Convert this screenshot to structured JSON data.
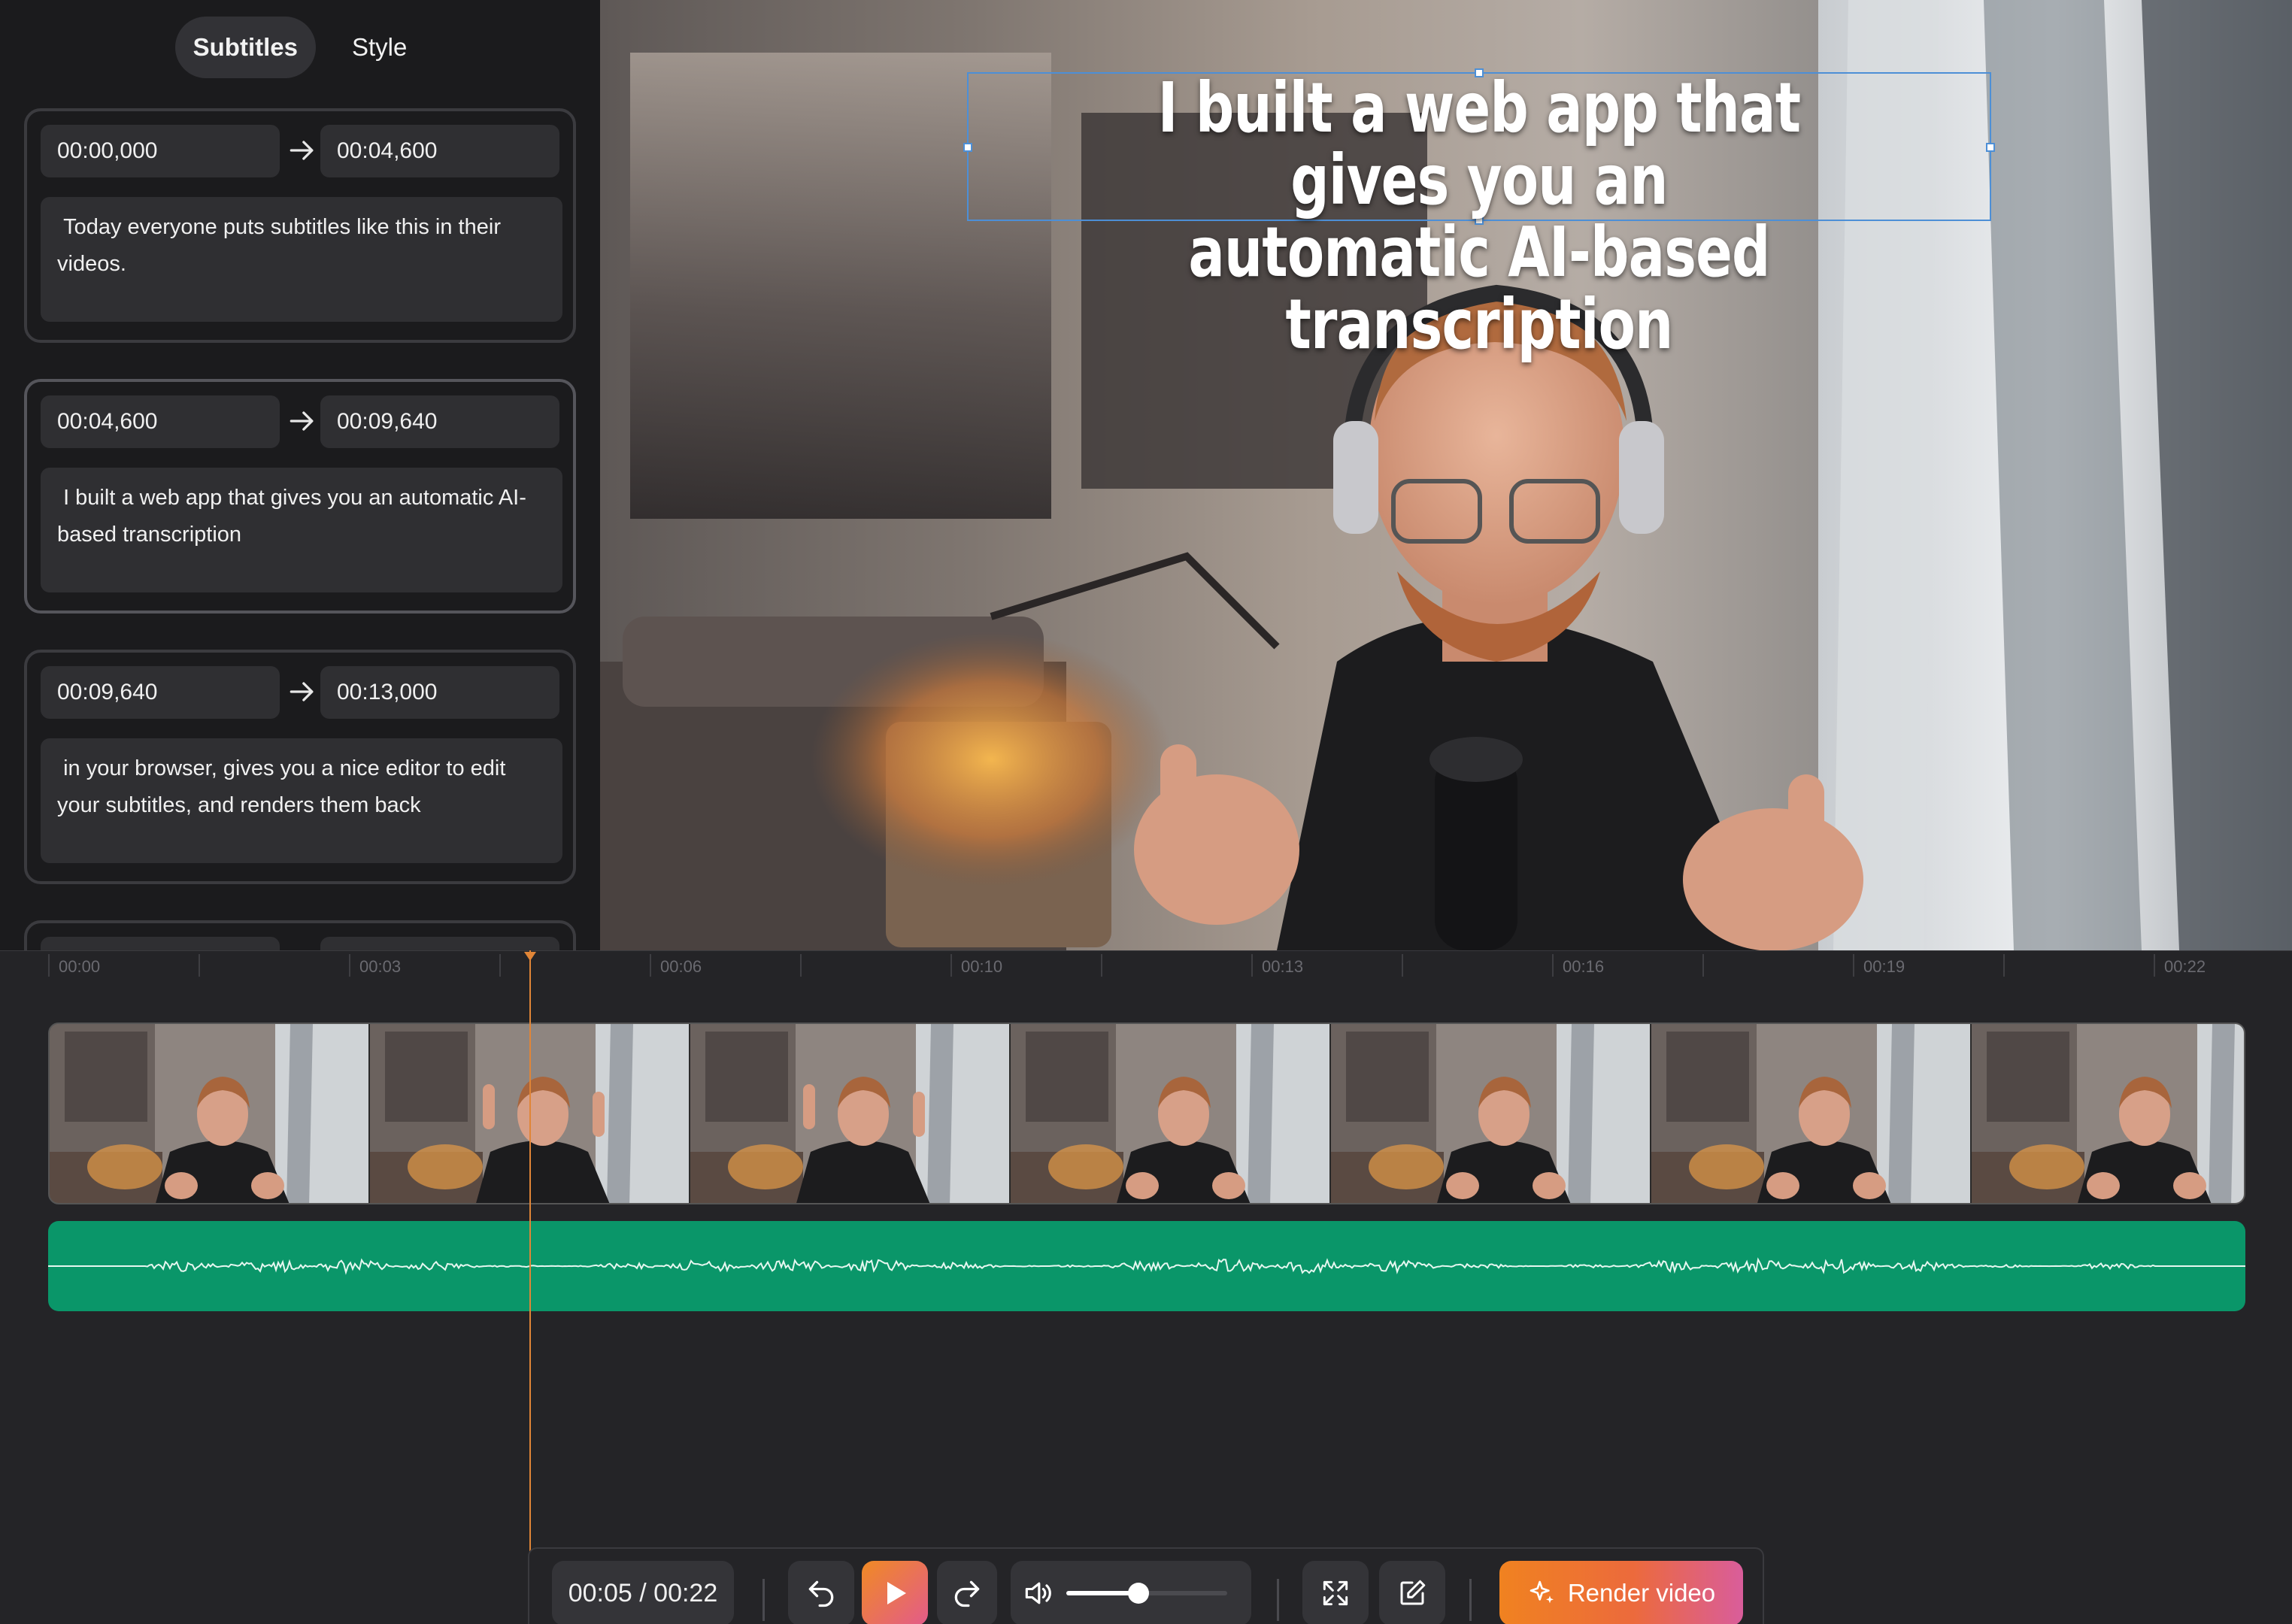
{
  "tabs": {
    "subtitles": "Subtitles",
    "style": "Style"
  },
  "subtitles": [
    {
      "start": "00:00,000",
      "end": "00:04,600",
      "text": " Today everyone puts subtitles like this in their videos."
    },
    {
      "start": "00:04,600",
      "end": "00:09,640",
      "text": " I built a web app that gives you an automatic AI-based transcription"
    },
    {
      "start": "00:09,640",
      "end": "00:13,000",
      "text": " in your browser, gives you a nice editor to edit your subtitles, and renders them back"
    }
  ],
  "preview": {
    "caption_line1": "I built a web app that gives you an",
    "caption_line2": "automatic AI-based transcription"
  },
  "timeline": {
    "labels": [
      "00:00",
      "00:03",
      "00:06",
      "00:10",
      "00:13",
      "00:16",
      "00:19",
      "00:22"
    ],
    "playhead_time": "00:05"
  },
  "controls": {
    "timecode": "00:05 / 00:22",
    "volume_level": 0.45,
    "render_label": "Render video"
  },
  "colors": {
    "accent_orange": "#f08220",
    "accent_pink": "#d95d9b",
    "audio_track": "#0a9669",
    "playhead": "#e08537",
    "selection": "#4d8fd6"
  }
}
